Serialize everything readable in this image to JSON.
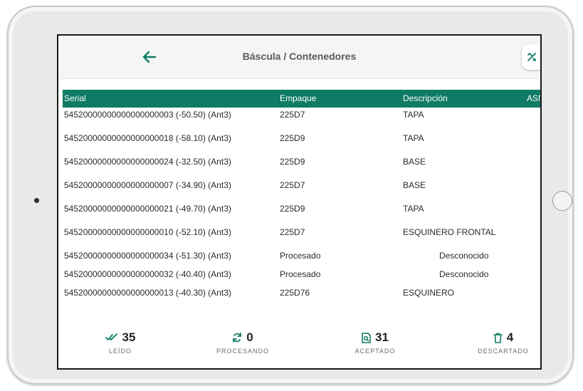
{
  "app": {
    "title": "Báscula / Contenedores"
  },
  "table": {
    "headers": [
      "Serial",
      "Empaque",
      "Descripción",
      "ASN"
    ],
    "rows": [
      {
        "serial": "54520000000000000000003 (-50.50) (Ant3)",
        "empaque": "225D7",
        "descripcion": "TAPA"
      },
      {
        "serial": "54520000000000000000018 (-58.10) (Ant3)",
        "empaque": "225D9",
        "descripcion": "TAPA"
      },
      {
        "serial": "54520000000000000000024 (-32.50) (Ant3)",
        "empaque": "225D9",
        "descripcion": "BASE"
      },
      {
        "serial": "54520000000000000000007 (-34.90) (Ant3)",
        "empaque": "225D7",
        "descripcion": "BASE"
      },
      {
        "serial": "54520000000000000000021 (-49.70) (Ant3)",
        "empaque": "225D9",
        "descripcion": "TAPA"
      },
      {
        "serial": "54520000000000000000010 (-52.10) (Ant3)",
        "empaque": "225D7",
        "descripcion": "ESQUINERO FRONTAL"
      },
      {
        "serial": "54520000000000000000034 (-51.30) (Ant3)",
        "empaque": "Procesado",
        "descripcion": "Desconocido"
      },
      {
        "serial": "54520000000000000000032 (-40.40) (Ant3)",
        "empaque": "Procesado",
        "descripcion": "Desconocido"
      },
      {
        "serial": "54520000000000000000013 (-40.30) (Ant3)",
        "empaque": "225D76",
        "descripcion": "ESQUINERO"
      }
    ]
  },
  "stats": [
    {
      "value": "35",
      "label": "LEÍDO",
      "icon": "double-check-icon"
    },
    {
      "value": "0",
      "label": "PROCESANDO",
      "icon": "sync-icon"
    },
    {
      "value": "31",
      "label": "ACEPTADO",
      "icon": "document-search-icon"
    },
    {
      "value": "4",
      "label": "DESCARTADO",
      "icon": "trash-icon"
    }
  ],
  "colors": {
    "accent": "#0f7b64",
    "header_text": "#ffffff"
  }
}
